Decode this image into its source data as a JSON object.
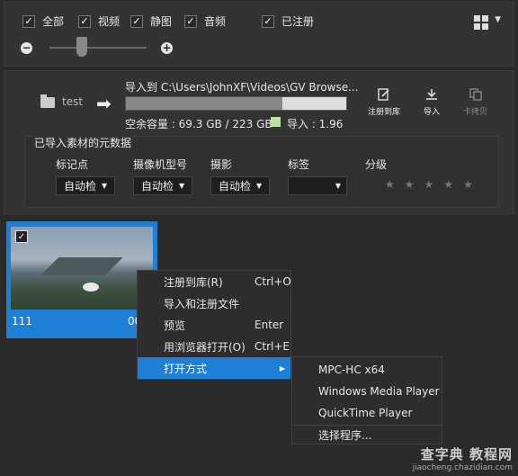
{
  "filters": {
    "all": "全部",
    "video": "视频",
    "still": "静图",
    "audio": "音频",
    "registered": "已注册"
  },
  "import": {
    "source_folder": "test",
    "destination": "导入到  C:\\Users\\JohnXF\\Videos\\GV Browse...",
    "used_fraction": 0.71,
    "free_space": "空余容量 : 69.3 GB / 223 GB",
    "import_size": "导入 : 1.96"
  },
  "toolbar": {
    "register": "注册到库",
    "import": "导入",
    "card_copy": "卡拷贝"
  },
  "metadata": {
    "title": "已导入素材的元数据",
    "columns": [
      "标记点",
      "摄像机型号",
      "摄影",
      "标签",
      "分级"
    ],
    "auto_value": "自动检",
    "rating_stars": 5
  },
  "clip": {
    "name": "111",
    "duration": "00"
  },
  "context_menu": {
    "items": [
      {
        "label": "注册到库(R)",
        "shortcut": "Ctrl+O"
      },
      {
        "label": "导入和注册文件",
        "shortcut": ""
      },
      {
        "label": "预览",
        "shortcut": "Enter"
      },
      {
        "label": "用浏览器打开(O)",
        "shortcut": "Ctrl+E"
      },
      {
        "label": "打开方式",
        "shortcut": ""
      }
    ]
  },
  "submenu": {
    "items": [
      "MPC-HC x64",
      "Windows Media Player",
      "QuickTime Player",
      "选择程序..."
    ]
  },
  "watermark": {
    "line1": "查字典 教程网",
    "line2": "jiaocheng.chazidian.com"
  },
  "colors": {
    "accent": "#1e7fd6",
    "legend_import": "#b9e39a"
  }
}
